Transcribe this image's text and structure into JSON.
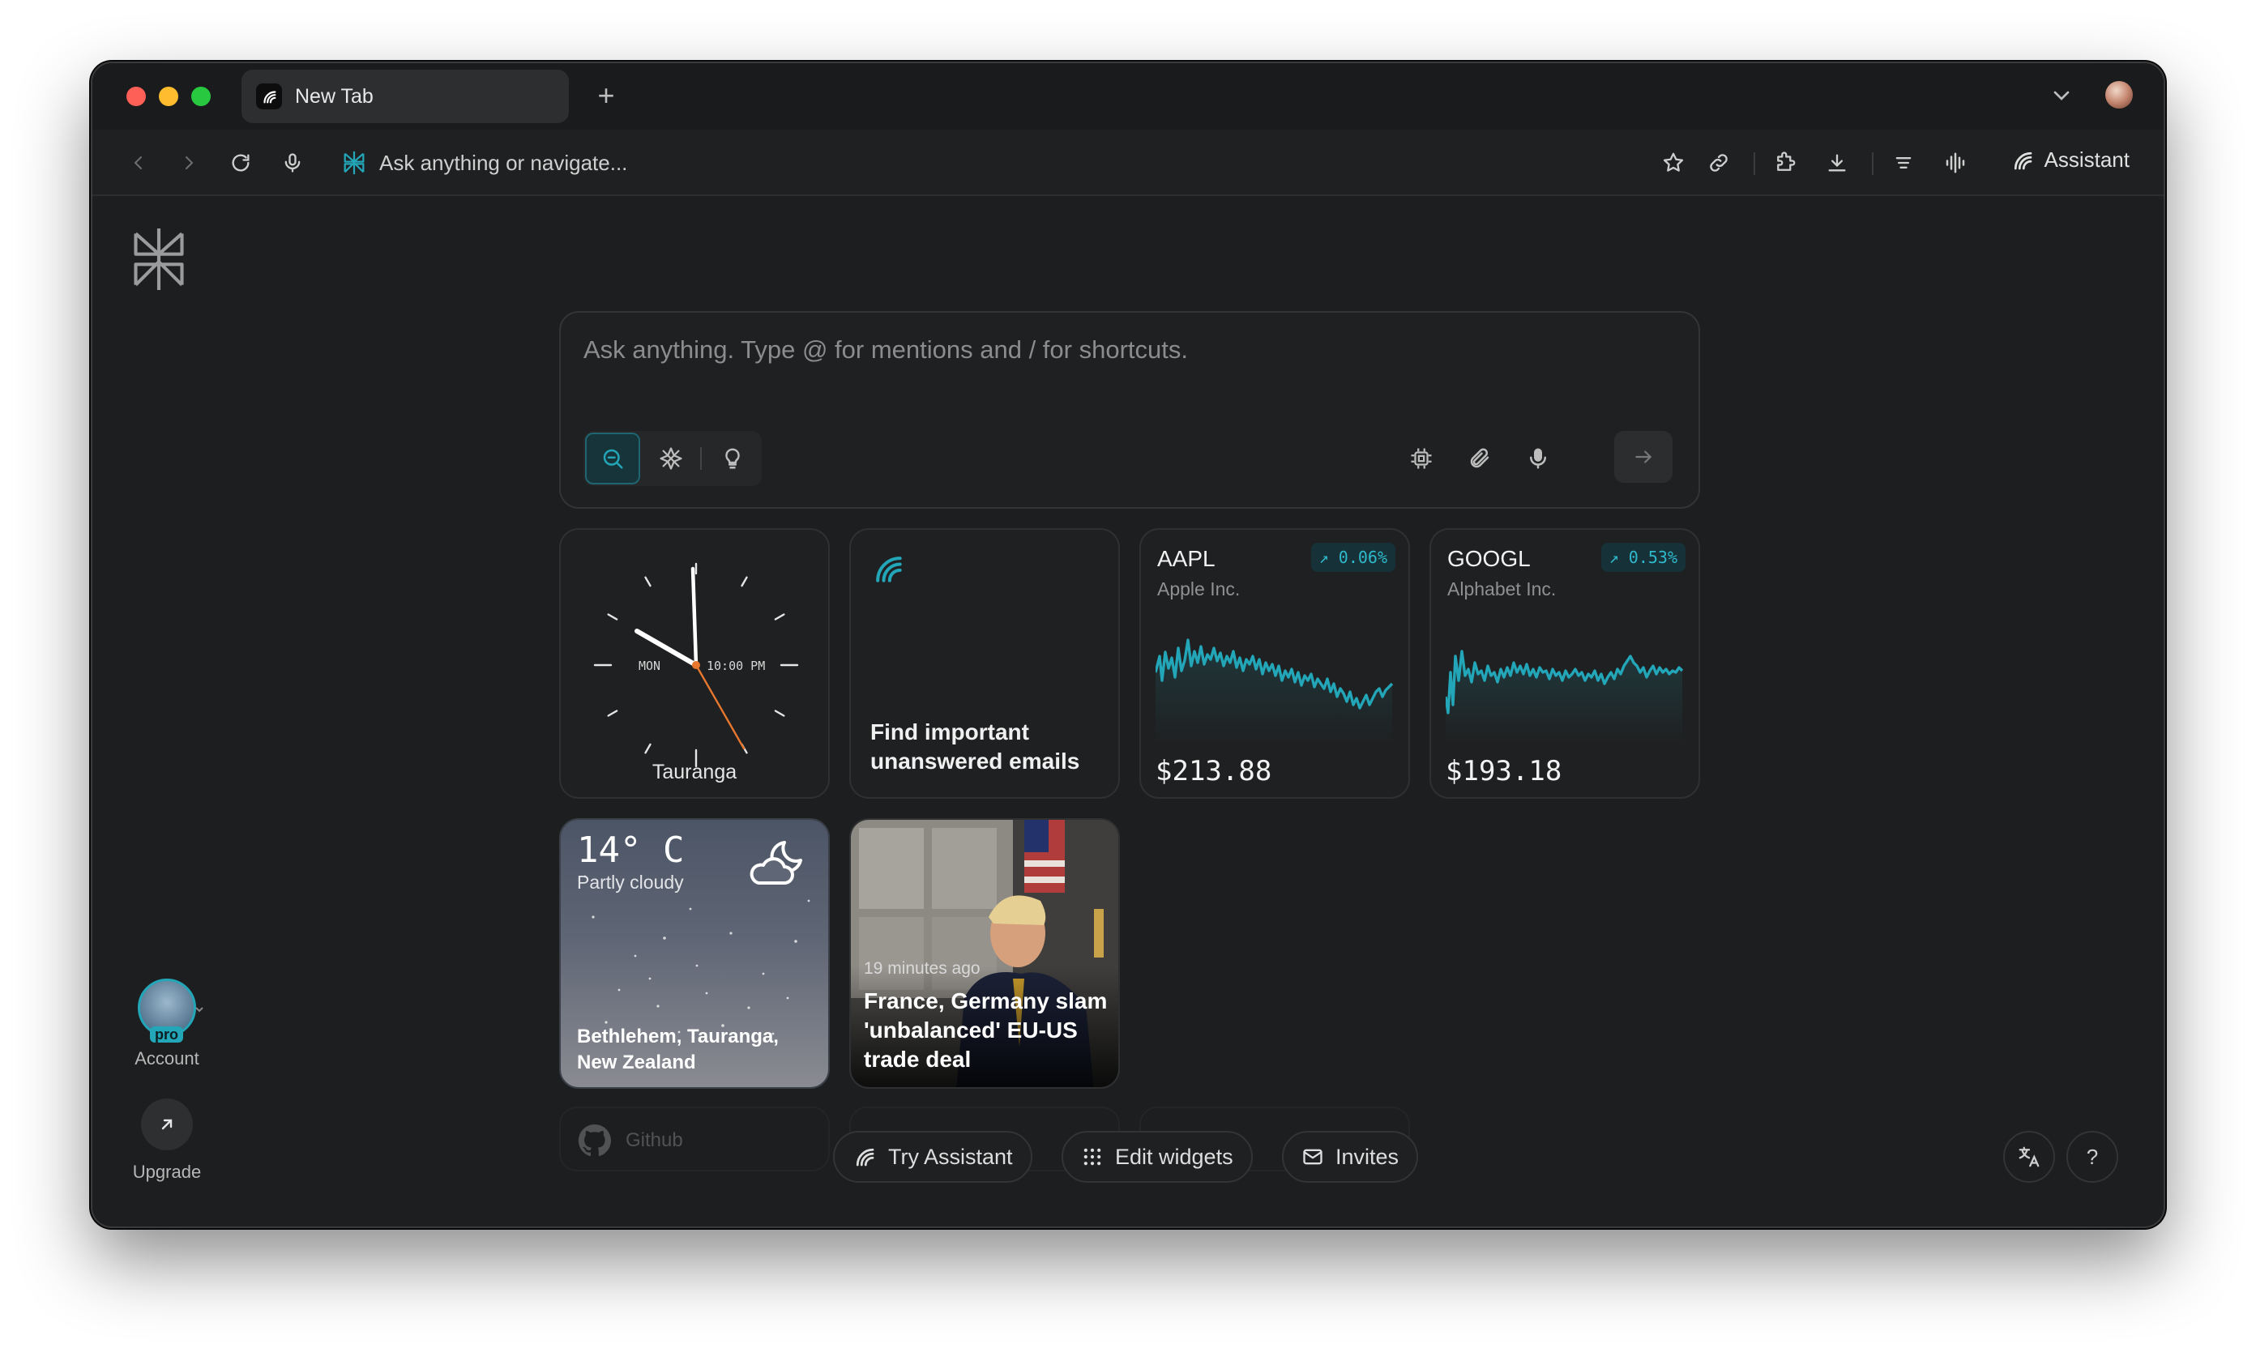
{
  "browser": {
    "tab_title": "New Tab",
    "new_tab_symbol": "+",
    "omnibox_placeholder": "Ask anything or navigate...",
    "assistant_label": "Assistant"
  },
  "sidebar": {
    "account_label": "Account",
    "account_badge": "pro",
    "upgrade_label": "Upgrade"
  },
  "ask": {
    "placeholder": "Ask anything. Type @ for mentions and / for shortcuts."
  },
  "widgets": {
    "clock": {
      "city": "Tauranga",
      "day": "MON",
      "time": "10:00 PM"
    },
    "task": {
      "text": "Find important unanswered emails"
    },
    "aapl": {
      "symbol": "AAPL",
      "name": "Apple Inc.",
      "change": "0.06%",
      "price": "$213.88"
    },
    "googl": {
      "symbol": "GOOGL",
      "name": "Alphabet Inc.",
      "change": "0.53%",
      "price": "$193.18"
    },
    "weather": {
      "temp": "14° C",
      "condition": "Partly cloudy",
      "location": "Bethlehem, Tauranga, New Zealand"
    },
    "news": {
      "time": "19 minutes ago",
      "title": "France, Germany slam 'unbalanced' EU-US trade deal"
    },
    "github": {
      "label": "Github"
    }
  },
  "bottom_bar": {
    "try_assistant": "Try Assistant",
    "edit_widgets": "Edit widgets",
    "invites": "Invites",
    "help": "?"
  },
  "colors": {
    "accent": "#22a6b8",
    "window_bg": "#1d1e1f",
    "clock_second_hand": "#e8772e"
  }
}
